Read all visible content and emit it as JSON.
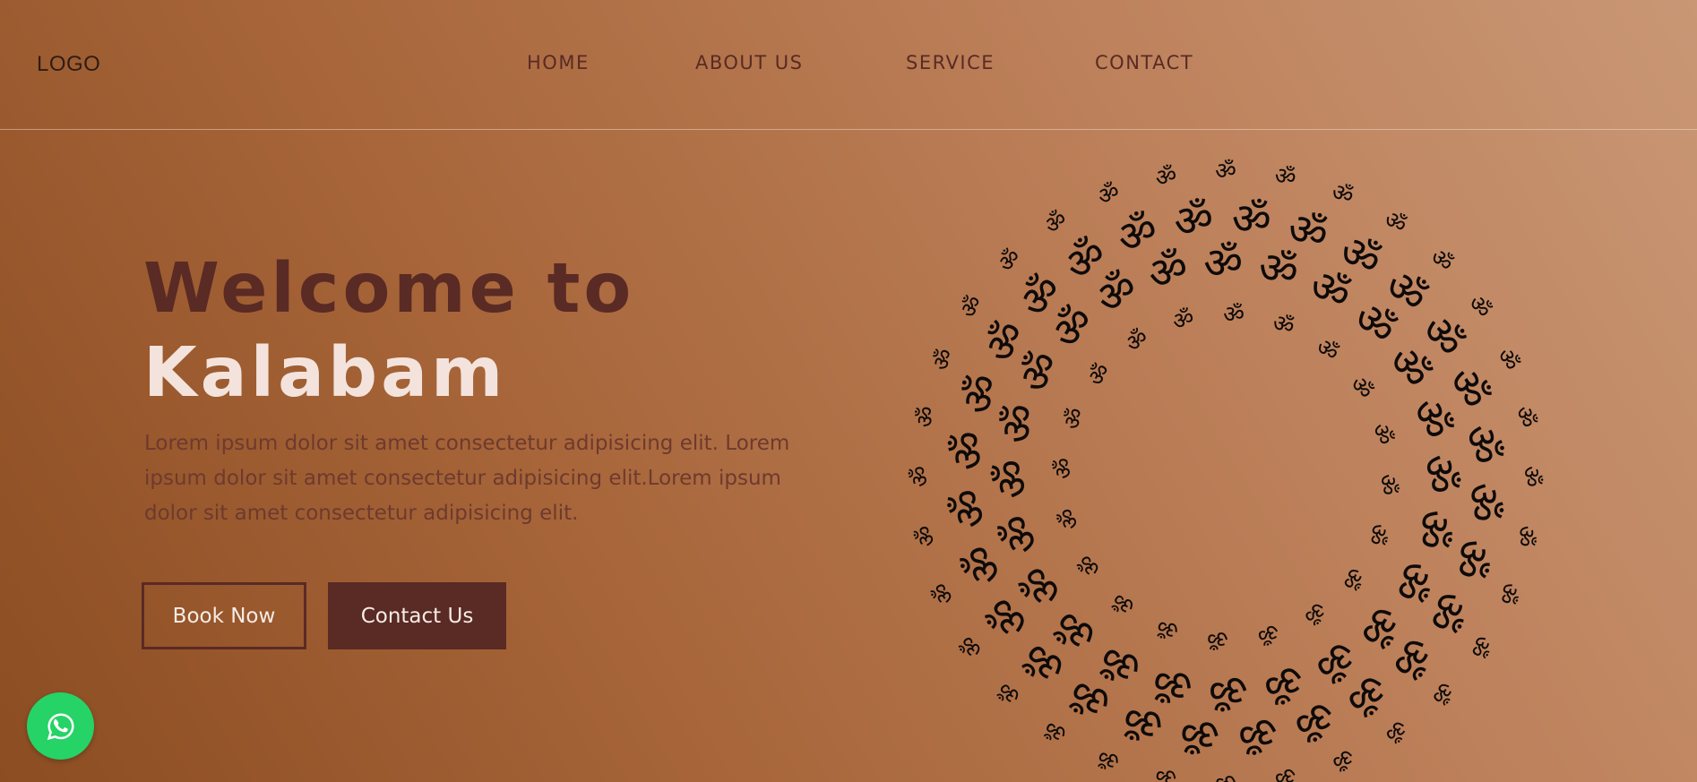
{
  "header": {
    "logo_text": "LOGO",
    "nav": [
      {
        "label": "HOME"
      },
      {
        "label": "ABOUT US"
      },
      {
        "label": "SERVICE"
      },
      {
        "label": "CONTACT"
      }
    ]
  },
  "hero": {
    "title_line1": "Welcome to",
    "title_line2": "Kalabam",
    "description": "Lorem ipsum dolor sit amet consectetur adipisicing elit. Lorem ipsum dolor sit amet consectetur adipisicing elit.Lorem ipsum dolor sit amet consectetur adipisicing elit.",
    "book_label": "Book Now",
    "contact_label": "Contact Us"
  },
  "decoration": {
    "ring_symbol": "ॐ",
    "ring_color": "#0e0a09"
  },
  "whatsapp": {
    "icon": "whatsapp-icon",
    "color": "#25d366"
  },
  "colors": {
    "accent": "#5a2a24",
    "light_text": "#f3e3dc"
  }
}
